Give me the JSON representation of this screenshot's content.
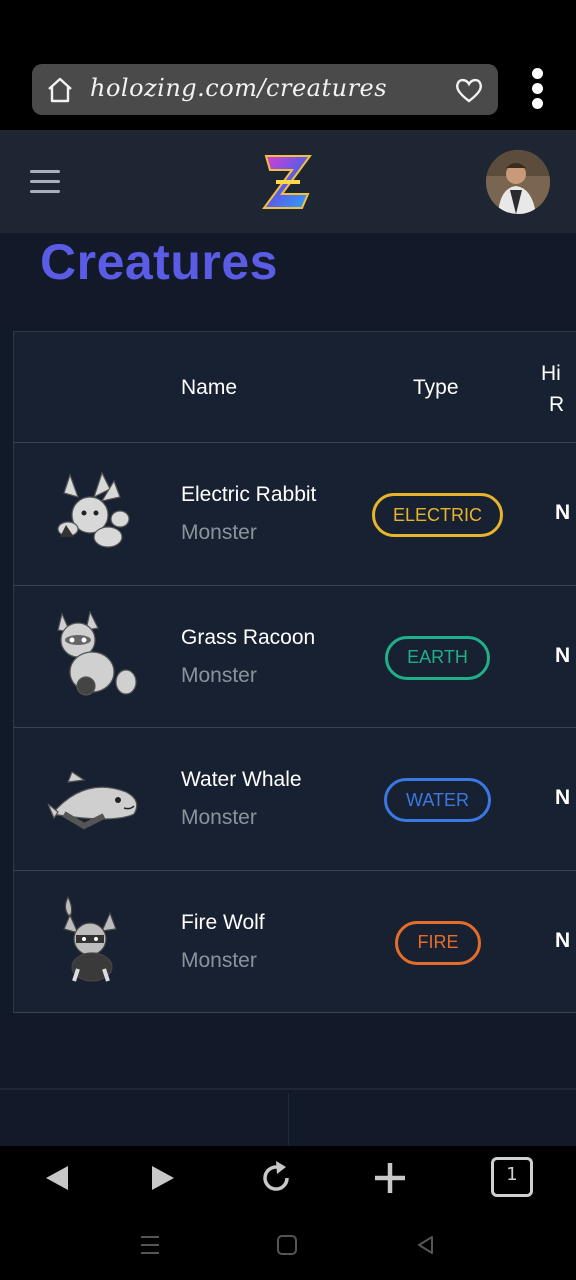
{
  "browser": {
    "url": "holozing.com/creatures",
    "tab_count": "1",
    "icons": [
      "home-icon",
      "heart-icon",
      "kebab-menu-icon",
      "back-icon",
      "forward-icon",
      "reload-icon",
      "plus-icon"
    ]
  },
  "header": {
    "logo_letter": "Z",
    "menu_icon": "hamburger-icon"
  },
  "page": {
    "title": "Creatures"
  },
  "table": {
    "columns": {
      "name": "Name",
      "type": "Type",
      "extra_line1": "Hi",
      "extra_line2": "R"
    },
    "rows": [
      {
        "name": "Electric Rabbit",
        "kind": "Monster",
        "type": "ELECTRIC",
        "color": "#e7b52c",
        "edge": "N"
      },
      {
        "name": "Grass Racoon",
        "kind": "Monster",
        "type": "EARTH",
        "color": "#1fb08a",
        "edge": "N"
      },
      {
        "name": "Water Whale",
        "kind": "Monster",
        "type": "WATER",
        "color": "#3a78e4",
        "edge": "N"
      },
      {
        "name": "Fire Wolf",
        "kind": "Monster",
        "type": "FIRE",
        "color": "#e56d2a",
        "edge": "N"
      }
    ]
  },
  "colors": {
    "title": "#5b5ce6",
    "page_bg": "#121a2a",
    "header_bg": "#1e2533",
    "table_bg": "#182131"
  }
}
